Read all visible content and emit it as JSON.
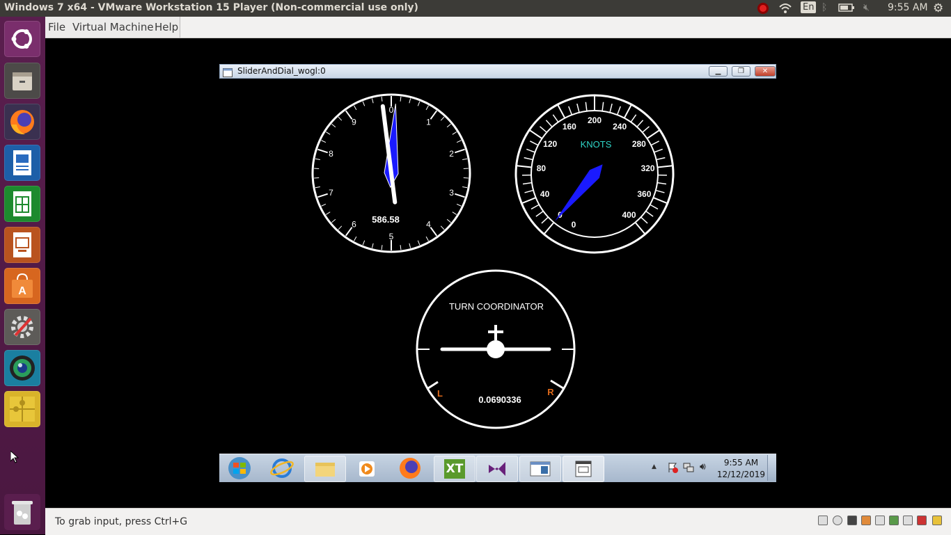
{
  "top_panel": {
    "title": "Windows 7 x64 - VMware Workstation 15 Player (Non-commercial use only)",
    "clock": "9:55 AM",
    "keyboard_layout": "En",
    "icons": [
      "record-icon",
      "wifi-icon",
      "keyboard-layout-icon",
      "bluetooth-icon",
      "battery-icon",
      "volume-muted-icon",
      "gear-icon"
    ]
  },
  "launcher": {
    "items": [
      "ubuntu-dash-icon",
      "files-icon",
      "firefox-icon",
      "writer-icon",
      "calc-icon",
      "impress-icon",
      "software-center-icon",
      "system-settings-icon",
      "camera-app-icon",
      "puzzle-app-icon",
      "trash-icon"
    ]
  },
  "vm_menu": {
    "items": [
      "File",
      "Virtual Machine",
      "Help"
    ]
  },
  "guest_window": {
    "title": "SliderAndDial_wogl:0"
  },
  "clock_gauge": {
    "ticks": [
      "0",
      "1",
      "2",
      "3",
      "4",
      "5",
      "6",
      "7",
      "8",
      "9"
    ],
    "value_text": "586.58",
    "long_hand_value": 0.1,
    "short_hand_value": 9.8
  },
  "airspeed_gauge": {
    "label": "KNOTS",
    "ticks": [
      "0",
      "40",
      "80",
      "120",
      "160",
      "200",
      "240",
      "280",
      "320",
      "360",
      "400"
    ],
    "extra_label": "0",
    "needle_value": 0
  },
  "turn_coordinator": {
    "label": "TURN COORDINATOR",
    "left_label": "L",
    "right_label": "R",
    "value_text": "0.0690336"
  },
  "taskbar": {
    "time": "9:55 AM",
    "date": "12/12/2019",
    "buttons": [
      "start-button",
      "ie-icon",
      "explorer-icon",
      "media-player-icon",
      "firefox-icon",
      "xt-app-icon",
      "visual-studio-icon",
      "app-window-icon",
      "app-window-2-icon"
    ],
    "xt_label": "XT"
  },
  "status_bar": {
    "message": "To grab input, press Ctrl+G"
  }
}
